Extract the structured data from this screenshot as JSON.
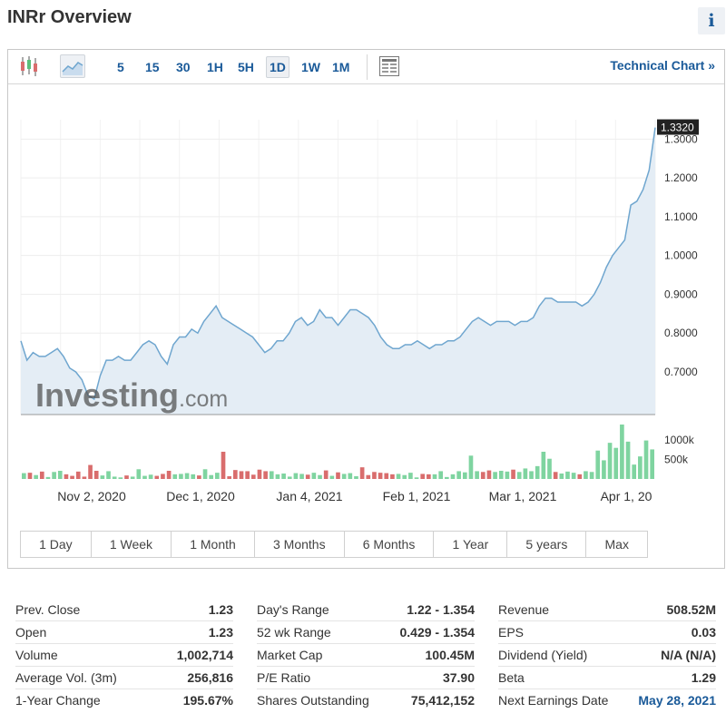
{
  "header": {
    "title": "INRr Overview",
    "info_icon": "i"
  },
  "toolbar": {
    "intervals": [
      "5",
      "15",
      "30",
      "1H",
      "5H",
      "1D",
      "1W",
      "1M"
    ],
    "active_interval": "1D",
    "technical_chart": "Technical Chart »"
  },
  "chart_data": {
    "type": "area",
    "x_labels": [
      "Nov 2, 2020",
      "Dec 1, 2020",
      "Jan 4, 2021",
      "Feb 1, 2021",
      "Mar 1, 2021",
      "Apr 1, 20"
    ],
    "y_ticks": [
      "1.3000",
      "1.2000",
      "1.1000",
      "1.0000",
      "0.9000",
      "0.8000",
      "0.7000"
    ],
    "ylim": [
      0.59,
      1.35
    ],
    "price": [
      0.78,
      0.73,
      0.75,
      0.74,
      0.74,
      0.75,
      0.76,
      0.74,
      0.71,
      0.7,
      0.68,
      0.64,
      0.63,
      0.69,
      0.73,
      0.73,
      0.74,
      0.73,
      0.73,
      0.75,
      0.77,
      0.78,
      0.77,
      0.74,
      0.72,
      0.77,
      0.79,
      0.79,
      0.81,
      0.8,
      0.83,
      0.85,
      0.87,
      0.84,
      0.83,
      0.82,
      0.81,
      0.8,
      0.79,
      0.77,
      0.75,
      0.76,
      0.78,
      0.78,
      0.8,
      0.83,
      0.84,
      0.82,
      0.83,
      0.86,
      0.84,
      0.84,
      0.82,
      0.84,
      0.86,
      0.86,
      0.85,
      0.84,
      0.82,
      0.79,
      0.77,
      0.76,
      0.76,
      0.77,
      0.77,
      0.78,
      0.77,
      0.76,
      0.77,
      0.77,
      0.78,
      0.78,
      0.79,
      0.81,
      0.83,
      0.84,
      0.83,
      0.82,
      0.83,
      0.83,
      0.83,
      0.82,
      0.83,
      0.83,
      0.84,
      0.87,
      0.89,
      0.89,
      0.88,
      0.88,
      0.88,
      0.88,
      0.87,
      0.88,
      0.9,
      0.93,
      0.97,
      1.0,
      1.02,
      1.04,
      1.13,
      1.14,
      1.17,
      1.22,
      1.33
    ],
    "last_price": "1.3320",
    "volume_ticks": [
      "1000k",
      "500k"
    ],
    "volume": [
      150,
      160,
      100,
      190,
      50,
      180,
      210,
      120,
      80,
      190,
      60,
      360,
      210,
      90,
      200,
      60,
      40,
      90,
      60,
      250,
      80,
      110,
      80,
      130,
      210,
      120,
      130,
      150,
      120,
      90,
      250,
      100,
      160,
      700,
      70,
      230,
      200,
      200,
      110,
      240,
      200,
      200,
      120,
      140,
      60,
      150,
      130,
      110,
      160,
      100,
      220,
      80,
      170,
      130,
      150,
      70,
      300,
      100,
      180,
      160,
      150,
      120,
      130,
      100,
      160,
      40,
      130,
      120,
      120,
      200,
      50,
      120,
      200,
      170,
      600,
      200,
      180,
      220,
      180,
      210,
      190,
      240,
      180,
      270,
      200,
      330,
      700,
      520,
      180,
      140,
      190,
      160,
      120,
      200,
      180,
      730,
      480,
      930,
      800,
      1400,
      960,
      370,
      580,
      990,
      760
    ],
    "volume_ylim": [
      0,
      1400
    ]
  },
  "ranges": [
    "1 Day",
    "1 Week",
    "1 Month",
    "3 Months",
    "6 Months",
    "1 Year",
    "5 years",
    "Max"
  ],
  "stats": {
    "col1": [
      {
        "label": "Prev. Close",
        "value": "1.23"
      },
      {
        "label": "Open",
        "value": "1.23"
      },
      {
        "label": "Volume",
        "value": "1,002,714"
      },
      {
        "label": "Average Vol. (3m)",
        "value": "256,816"
      },
      {
        "label": "1-Year Change",
        "value": "195.67%"
      }
    ],
    "col2": [
      {
        "label": "Day's Range",
        "value": "1.22 - 1.354"
      },
      {
        "label": "52 wk Range",
        "value": "0.429 - 1.354"
      },
      {
        "label": "Market Cap",
        "value": "100.45M"
      },
      {
        "label": "P/E Ratio",
        "value": "37.90"
      },
      {
        "label": "Shares Outstanding",
        "value": "75,412,152"
      }
    ],
    "col3": [
      {
        "label": "Revenue",
        "value": "508.52M"
      },
      {
        "label": "EPS",
        "value": "0.03"
      },
      {
        "label": "Dividend (Yield)",
        "value": "N/A (N/A)"
      },
      {
        "label": "Beta",
        "value": "1.29"
      },
      {
        "label": "Next Earnings Date",
        "value": "May 28, 2021"
      }
    ]
  },
  "watermark": "Investing.com",
  "colors": {
    "line": "#6fa6cf",
    "fill": "#e4edf5",
    "vol_up": "#7fd4a0",
    "vol_down": "#d96d6d",
    "accent": "#1a5a99"
  }
}
